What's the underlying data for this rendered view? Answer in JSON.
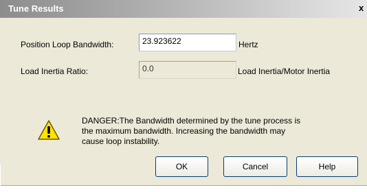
{
  "window": {
    "title": "Tune Results",
    "close_label": "x"
  },
  "fields": {
    "bandwidth": {
      "label": "Position Loop Bandwidth:",
      "value": "23.923622",
      "unit": "Hertz"
    },
    "inertia": {
      "label": "Load Inertia Ratio:",
      "value": "0.0",
      "unit": "Load Inertia/Motor Inertia"
    }
  },
  "warning": {
    "icon": "warning-icon",
    "lines": [
      "DANGER:The Bandwidth determined by the tune process is",
      "the maximum bandwidth. Increasing the bandwidth may",
      "cause loop instability."
    ]
  },
  "buttons": {
    "ok": "OK",
    "cancel": "Cancel",
    "help": "Help"
  }
}
